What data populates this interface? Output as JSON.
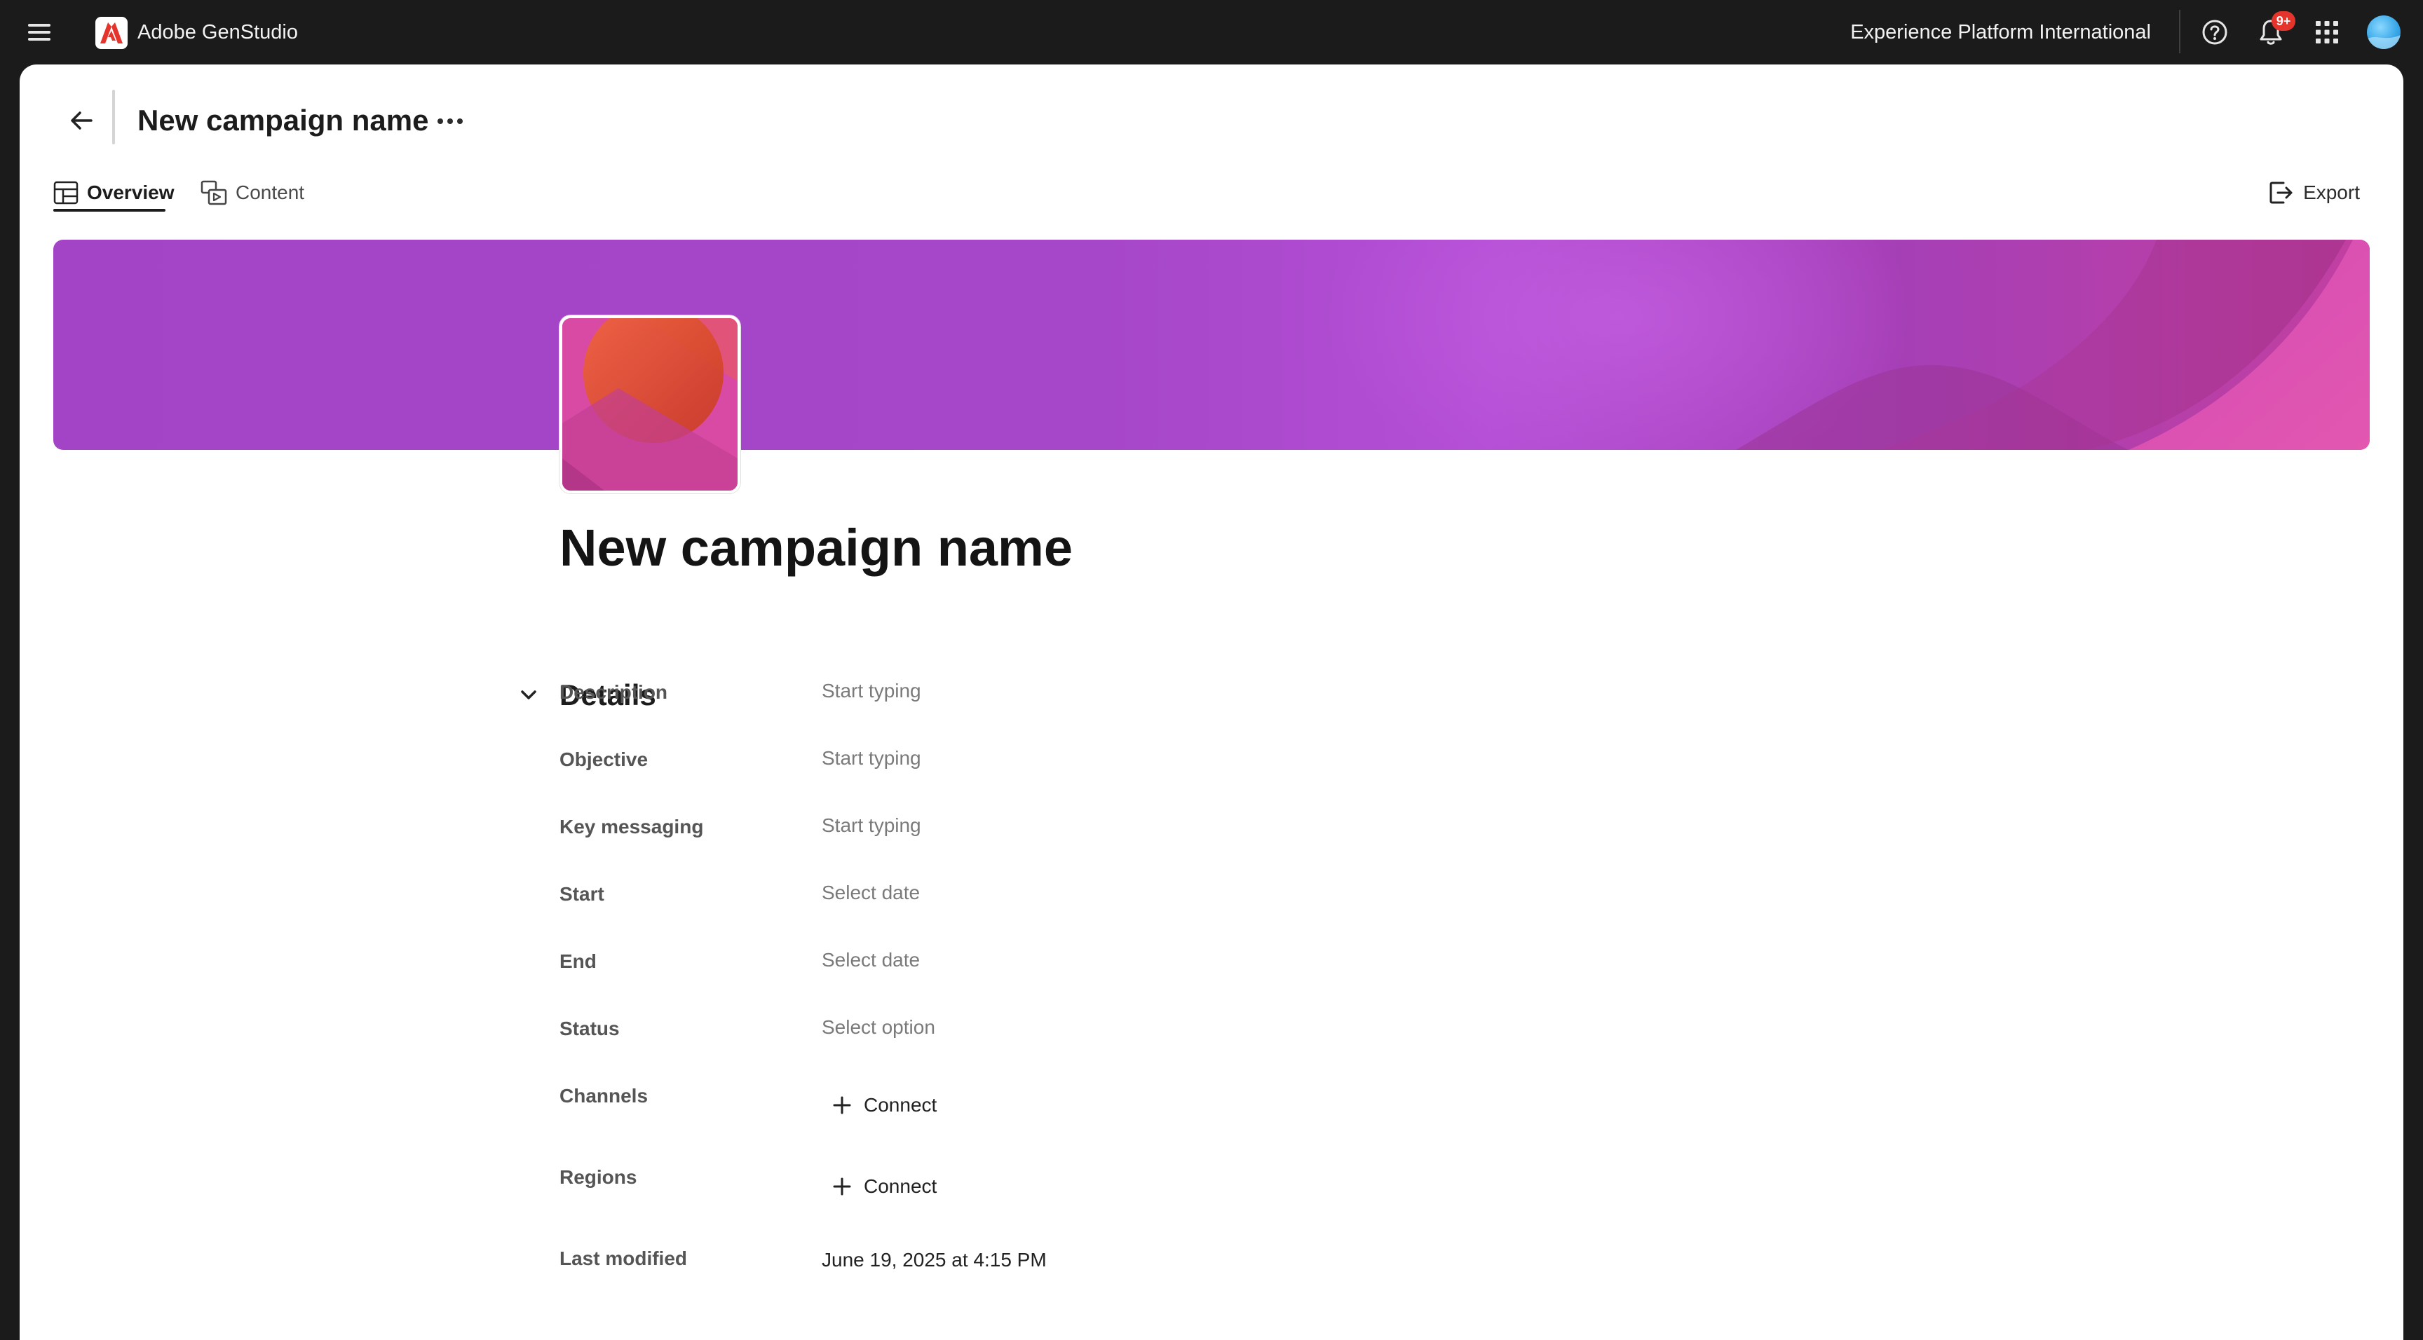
{
  "app": {
    "brand_name": "Adobe GenStudio",
    "org_name": "Experience Platform International",
    "notification_badge": "9+"
  },
  "header": {
    "title": "New campaign name"
  },
  "tabs": [
    {
      "label": "Overview",
      "active": true
    },
    {
      "label": "Content",
      "active": false
    }
  ],
  "toolbar": {
    "export_label": "Export"
  },
  "campaign": {
    "title": "New campaign name"
  },
  "details": {
    "heading": "Details",
    "fields": [
      {
        "label": "Description",
        "value": "Start typing"
      },
      {
        "label": "Objective",
        "value": "Start typing"
      },
      {
        "label": "Key messaging",
        "value": "Start typing"
      },
      {
        "label": "Start",
        "value": "Select date"
      },
      {
        "label": "End",
        "value": "Select date"
      },
      {
        "label": "Status",
        "value": "Select option"
      },
      {
        "label": "Channels",
        "value": "Connect"
      },
      {
        "label": "Regions",
        "value": "Connect"
      },
      {
        "label": "Last modified",
        "value": "June 19, 2025 at 4:15 PM"
      }
    ]
  },
  "colors": {
    "banner": "#a646c8",
    "brand_red": "#e5342b",
    "thumb_pink": "#d54aa2"
  },
  "icons": {
    "menu": "hamburger-icon",
    "logo": "adobe-logo-icon",
    "help": "help-icon",
    "notifications": "bell-icon",
    "apps": "app-grid-icon",
    "back": "arrow-left-icon",
    "more": "more-icon",
    "overview_tab": "layout-icon",
    "content_tab": "content-icon",
    "export": "export-icon",
    "collapse": "chevron-down-icon",
    "add": "plus-icon"
  }
}
